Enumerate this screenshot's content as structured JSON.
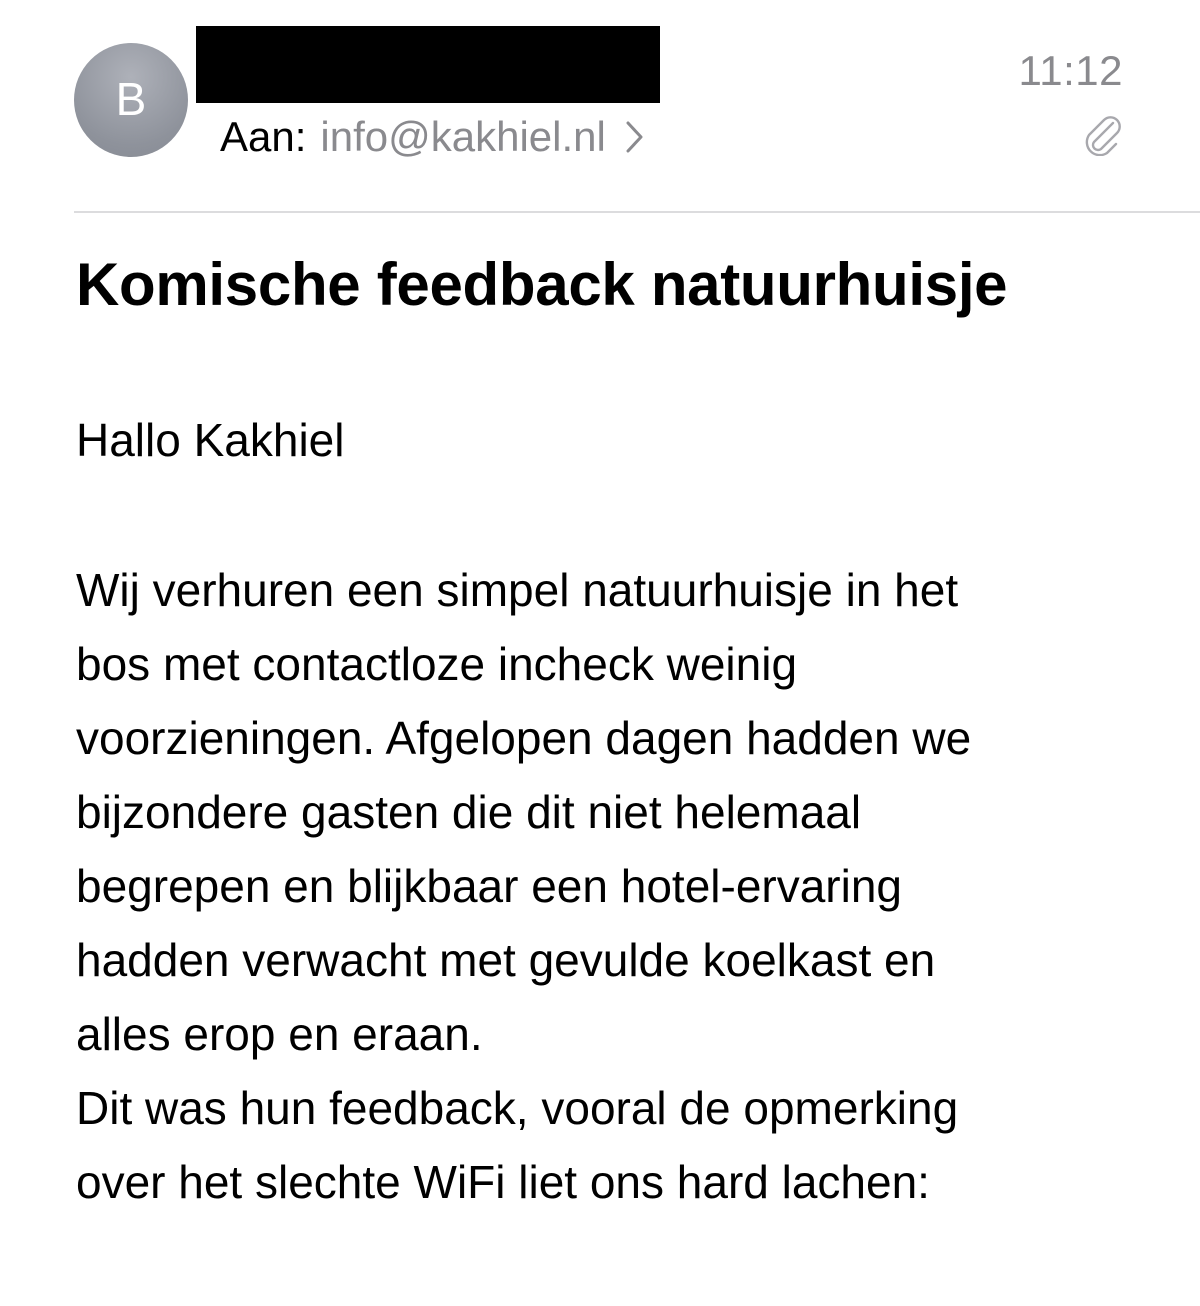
{
  "header": {
    "avatar_letter": "B",
    "time": "11:12",
    "to_label": "Aan:",
    "to_address": "info@kakhiel.nl",
    "icons": {
      "chevron": "chevron-right-icon",
      "attachment": "paperclip-icon"
    }
  },
  "message": {
    "subject": "Komische feedback natuurhuisje",
    "greeting": "Hallo Kakhiel",
    "body": "Wij verhuren een simpel natuurhuisje in het\nbos met contactloze incheck weinig\nvoorzieningen. Afgelopen dagen hadden we\nbijzondere gasten die dit niet helemaal\nbegrepen en blijkbaar een hotel-ervaring\nhadden verwacht met gevulde koelkast en\nalles erop en eraan.\nDit was hun feedback, vooral de opmerking\nover het slechte WiFi liet ons hard lachen:"
  },
  "colors": {
    "secondary_text": "#8a8a8e",
    "avatar_bg": "#8e929b",
    "divider": "#dcdcde"
  }
}
